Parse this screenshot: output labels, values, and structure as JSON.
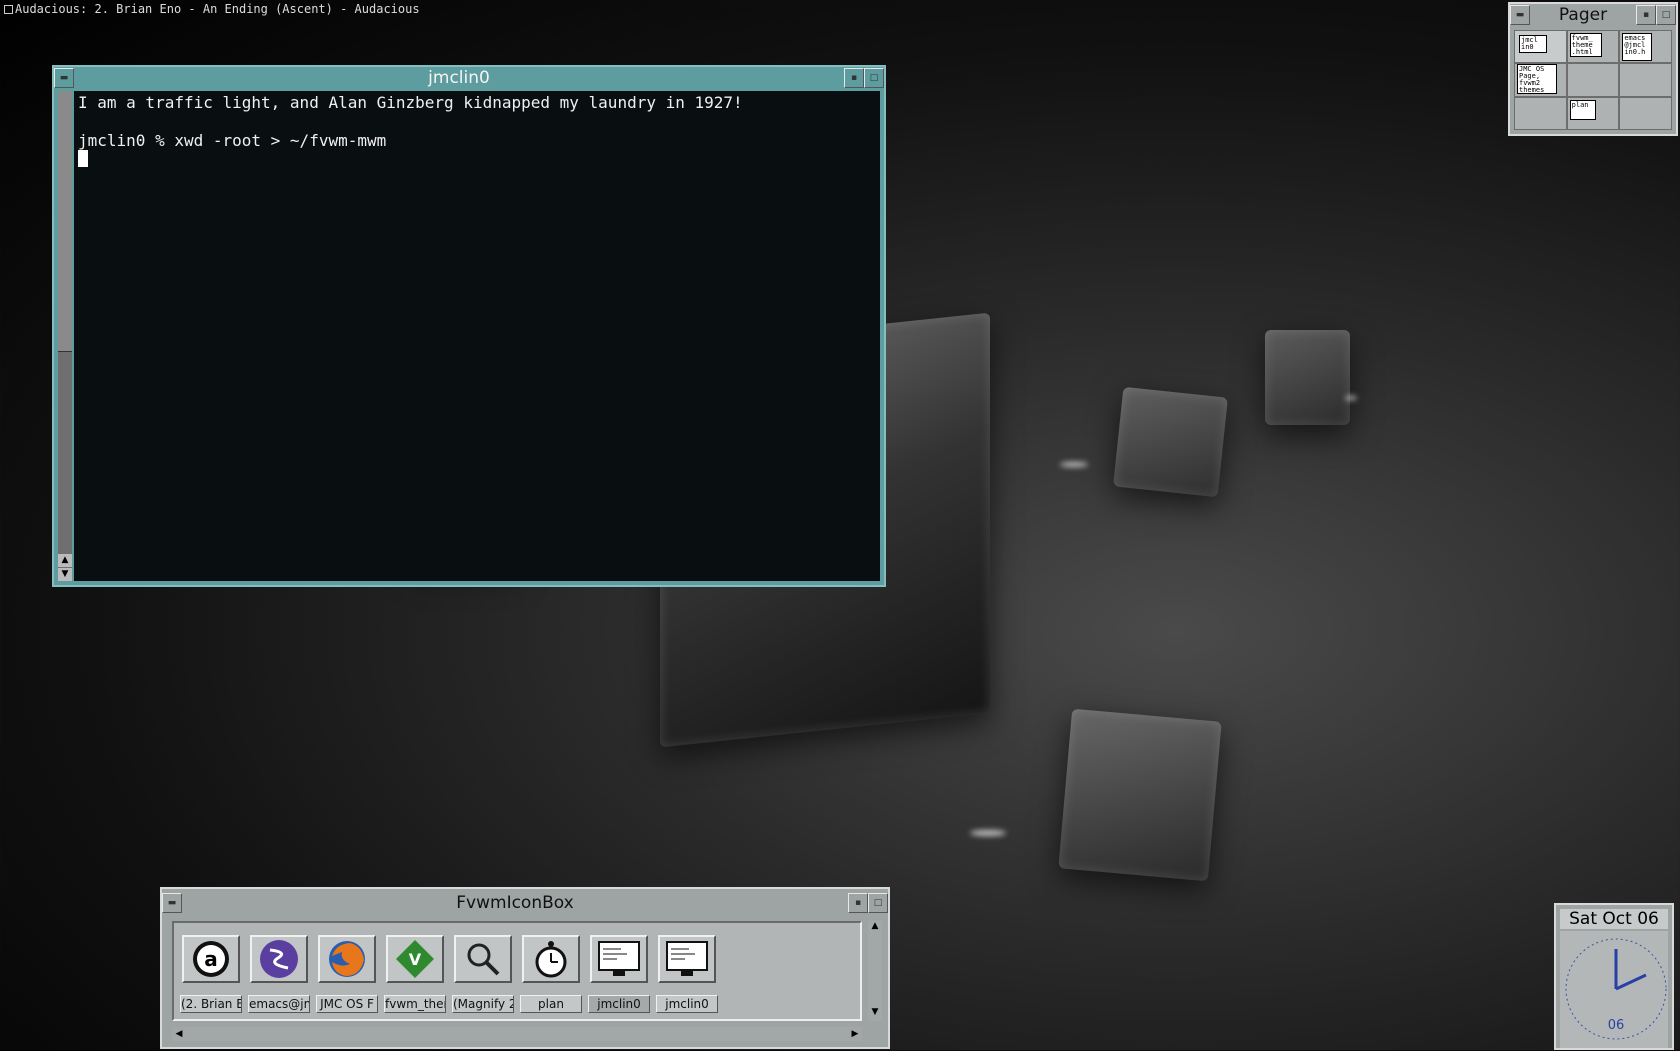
{
  "topbar": {
    "title": "Audacious: 2. Brian Eno - An Ending (Ascent) - Audacious"
  },
  "terminal": {
    "title": "jmclin0",
    "lines": [
      "I am a traffic light, and Alan Ginzberg kidnapped my laundry in 1927!",
      "",
      "jmclin0 % xwd -root > ~/fvwm-mwm"
    ]
  },
  "pager": {
    "title": "Pager",
    "minis": {
      "jmclin": "jmcl\nin0",
      "fvwm_theme": "fvwm_\ntheme\n.html",
      "emacs": "emacs\n@jmcl\nin0.h",
      "jmc_os": "JMC OS\nPage,\nfvwm2\nthemes",
      "plan": "plan"
    }
  },
  "iconbox": {
    "title": "FvwmIconBox",
    "labels": [
      "(2. Brian E",
      "emacs@jm",
      "JMC OS F",
      "fvwm_them",
      "(Magnify 2",
      "plan",
      "jmclin0",
      "jmclin0"
    ],
    "icons": [
      "audacious-icon",
      "emacs-icon",
      "firefox-icon",
      "vim-icon",
      "magnify-icon",
      "alarm-clock-icon",
      "terminal-icon",
      "terminal-icon"
    ]
  },
  "clock": {
    "date": "Sat Oct 06",
    "hour_label": "06"
  }
}
